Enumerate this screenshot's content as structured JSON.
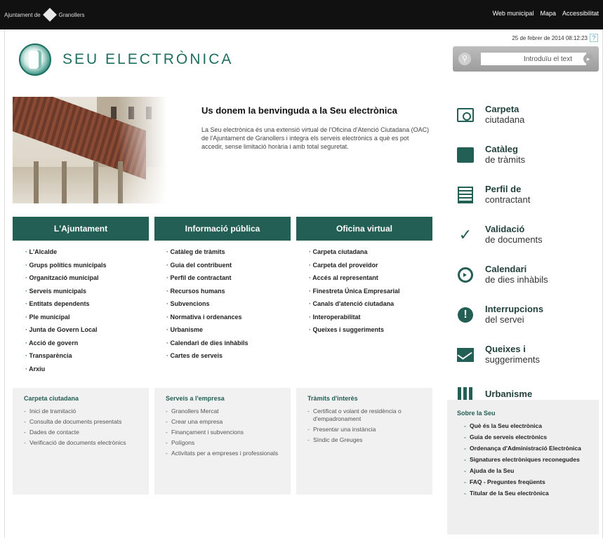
{
  "topbar": {
    "org_prefix": "Ajuntament de",
    "org_name": "Granollers",
    "links": [
      "Web municipal",
      "Mapa",
      "Accessibilitat"
    ]
  },
  "header": {
    "title": "SEU ELECTRÒNICA",
    "date": "25 de febrer de 2014 08:12:23",
    "help": "?"
  },
  "search": {
    "placeholder": "Introduïu el text"
  },
  "welcome": {
    "heading": "Us donem la benvinguda a la Seu electrònica",
    "body": "La Seu electrònica és una extensió virtual de l'Oficina d'Atenció Ciutadana (OAC) de l'Ajuntament de Granollers i integra els serveis electrònics a què es pot accedir, sense limitació horària i amb total seguretat."
  },
  "columns": [
    {
      "heading": "L'Ajuntament",
      "items": [
        "L'Alcalde",
        "Grups polítics municipals",
        "Organització municipal",
        "Serveis municipals",
        "Entitats dependents",
        "Ple municipal",
        "Junta de Govern Local",
        "Acció de govern",
        "Transparència",
        "Arxiu"
      ]
    },
    {
      "heading": "Informació pública",
      "items": [
        "Catàleg de tràmits",
        "Guia del contribuent",
        "Perfil de contractant",
        "Recursos humans",
        "Subvencions",
        "Normativa i ordenances",
        "Urbanisme",
        "Calendari de dies inhàbils",
        "Cartes de serveis"
      ]
    },
    {
      "heading": "Oficina virtual",
      "items": [
        "Carpeta ciutadana",
        "Carpeta del proveïdor",
        "Accés al representant",
        "Finestreta Única Empresarial",
        "Canals d'atenció ciutadana",
        "Interoperabilitat",
        "Queixes i suggeriments"
      ]
    }
  ],
  "panels": [
    {
      "heading": "Carpeta ciutadana",
      "items": [
        "Inici de tramitació",
        "Consulta de documents presentats",
        "Dades de contacte",
        "Verificació de documents electrònics"
      ]
    },
    {
      "heading": "Serveis a l'empresa",
      "items": [
        "Granollers Mercat",
        "Crear una empresa",
        "Finançament i subvencions",
        "Polígons",
        "Activitats per a empreses i professionals"
      ]
    },
    {
      "heading": "Tràmits d'interès",
      "items": [
        "Certificat o volant de residència o d'empadronament",
        "Presentar una instància",
        "Síndic de Greuges"
      ]
    }
  ],
  "services": [
    {
      "line1": "Carpeta",
      "line2": "ciutadana",
      "icon": "id-card-icon"
    },
    {
      "line1": "Catàleg",
      "line2": "de tràmits",
      "icon": "folder-icon"
    },
    {
      "line1": "Perfil de",
      "line2": "contractant",
      "icon": "document-icon"
    },
    {
      "line1": "Validació",
      "line2": "de documents",
      "icon": "checkmark-icon"
    },
    {
      "line1": "Calendari",
      "line2": "de dies inhàbils",
      "icon": "clock-icon"
    },
    {
      "line1": "Interrupcions",
      "line2": "del servei",
      "icon": "exclamation-icon"
    },
    {
      "line1": "Queixes i",
      "line2": "suggeriments",
      "icon": "mail-icon"
    },
    {
      "line1": "Urbanisme",
      "line2": "",
      "icon": "bars-icon"
    }
  ],
  "about": {
    "heading": "Sobre la Seu",
    "items": [
      "Què és la Seu electrònica",
      "Guia de serveis electrònics",
      "Ordenança d'Administració Electrònica",
      "Signatures electròniques reconegudes",
      "Ajuda de la Seu",
      "FAQ - Preguntes freqüents",
      "Titular de la Seu electrònica"
    ]
  }
}
